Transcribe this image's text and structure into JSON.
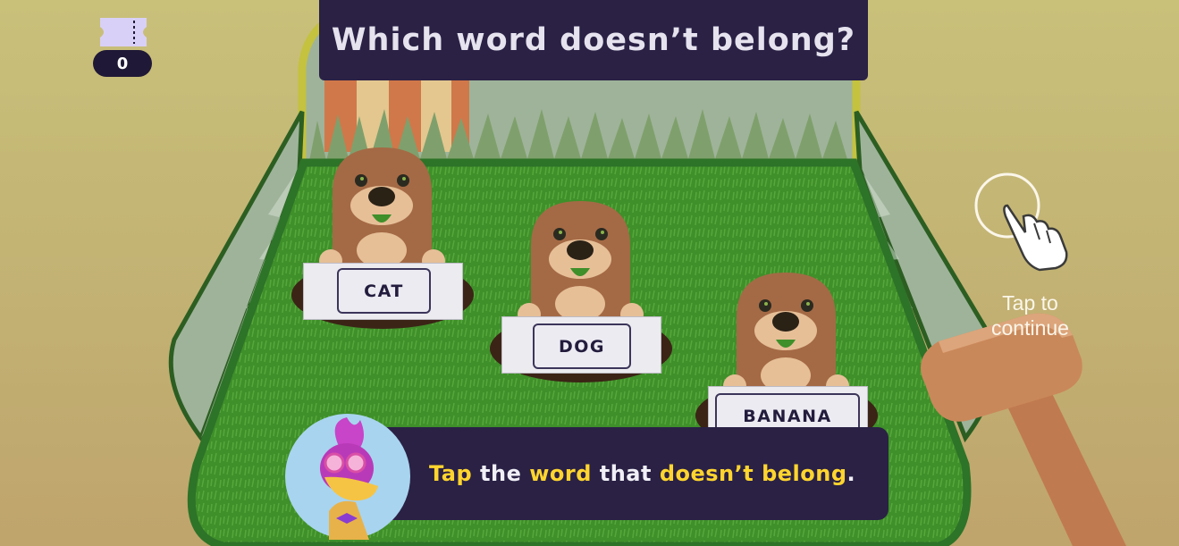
{
  "header": {
    "title": "Which word doesn’t belong?"
  },
  "tickets": {
    "count": "0",
    "icon": "ticket-icon"
  },
  "words": [
    {
      "label": "CAT"
    },
    {
      "label": "DOG"
    },
    {
      "label": "BANANA"
    }
  ],
  "hint": {
    "line1": "Tap to",
    "line2": "continue",
    "icon": "pointing-hand-icon"
  },
  "instruction": {
    "parts": [
      "Tap",
      " the ",
      "word",
      " that ",
      "doesn’t belong",
      "."
    ],
    "highlight_color": "#ffd52e",
    "text_color": "#f1eff6"
  },
  "colors": {
    "panel": "#2a2145",
    "grass": "#3f8f2a",
    "mole": "#a46a45"
  }
}
